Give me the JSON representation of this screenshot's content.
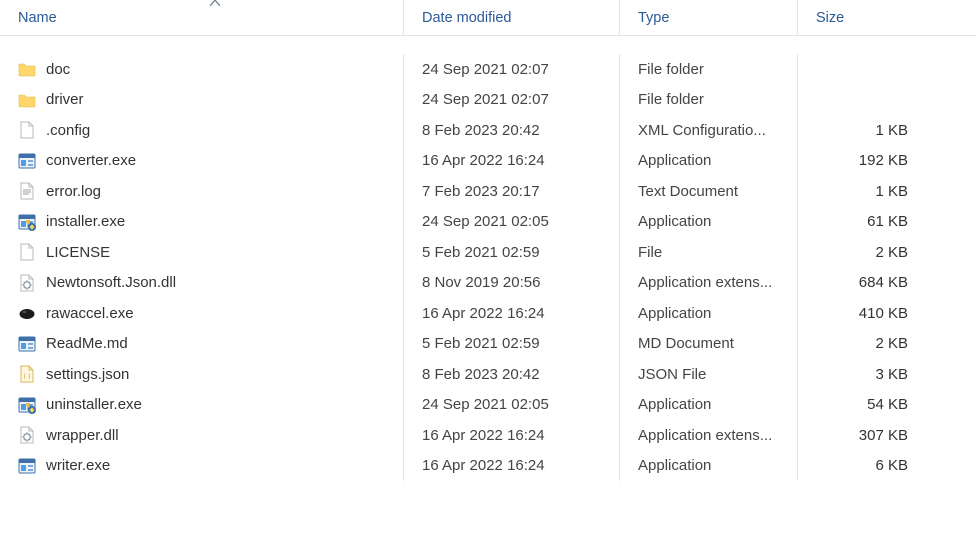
{
  "columns": {
    "name": "Name",
    "date": "Date modified",
    "type": "Type",
    "size": "Size"
  },
  "sort": {
    "column": "name",
    "direction": "asc"
  },
  "files": [
    {
      "icon": "folder",
      "name": "doc",
      "date": "24 Sep 2021 02:07",
      "type": "File folder",
      "size": ""
    },
    {
      "icon": "folder",
      "name": "driver",
      "date": "24 Sep 2021 02:07",
      "type": "File folder",
      "size": ""
    },
    {
      "icon": "blank",
      "name": ".config",
      "date": "8 Feb 2023 20:42",
      "type": "XML Configuratio...",
      "size": "1 KB"
    },
    {
      "icon": "exe",
      "name": "converter.exe",
      "date": "16 Apr 2022 16:24",
      "type": "Application",
      "size": "192 KB"
    },
    {
      "icon": "text",
      "name": "error.log",
      "date": "7 Feb 2023 20:17",
      "type": "Text Document",
      "size": "1 KB"
    },
    {
      "icon": "exeadm",
      "name": "installer.exe",
      "date": "24 Sep 2021 02:05",
      "type": "Application",
      "size": "61 KB"
    },
    {
      "icon": "blank",
      "name": "LICENSE",
      "date": "5 Feb 2021 02:59",
      "type": "File",
      "size": "2 KB"
    },
    {
      "icon": "dll",
      "name": "Newtonsoft.Json.dll",
      "date": "8 Nov 2019 20:56",
      "type": "Application extens...",
      "size": "684 KB"
    },
    {
      "icon": "appdark",
      "name": "rawaccel.exe",
      "date": "16 Apr 2022 16:24",
      "type": "Application",
      "size": "410 KB"
    },
    {
      "icon": "exe",
      "name": "ReadMe.md",
      "date": "5 Feb 2021 02:59",
      "type": "MD Document",
      "size": "2 KB"
    },
    {
      "icon": "json",
      "name": "settings.json",
      "date": "8 Feb 2023 20:42",
      "type": "JSON File",
      "size": "3 KB"
    },
    {
      "icon": "exeadm",
      "name": "uninstaller.exe",
      "date": "24 Sep 2021 02:05",
      "type": "Application",
      "size": "54 KB"
    },
    {
      "icon": "dll",
      "name": "wrapper.dll",
      "date": "16 Apr 2022 16:24",
      "type": "Application extens...",
      "size": "307 KB"
    },
    {
      "icon": "exe",
      "name": "writer.exe",
      "date": "16 Apr 2022 16:24",
      "type": "Application",
      "size": "6 KB"
    }
  ],
  "icons": {
    "folder": "folder-icon",
    "blank": "blank-file-icon",
    "exe": "exe-icon",
    "text": "text-file-icon",
    "exeadm": "exe-admin-icon",
    "dll": "dll-icon",
    "appdark": "app-dark-icon",
    "json": "json-file-icon"
  }
}
